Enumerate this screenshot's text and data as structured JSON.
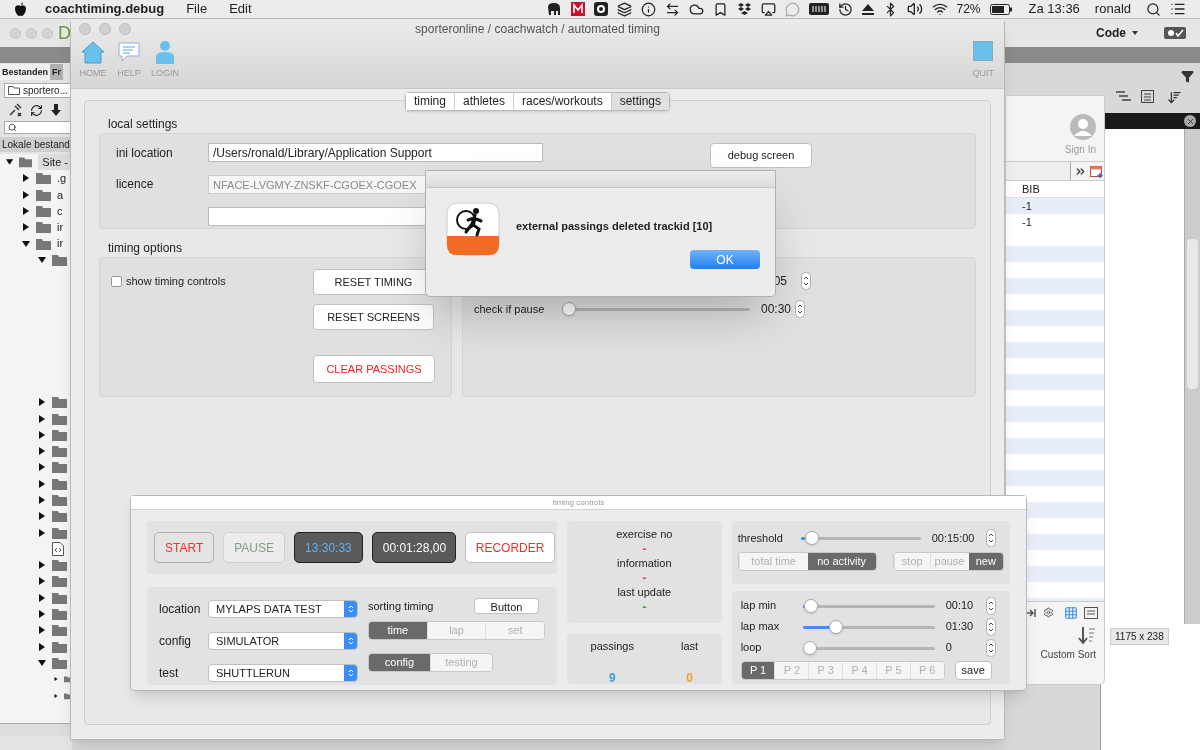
{
  "menubar": {
    "app": "coachtiming.debug",
    "menus": [
      "File",
      "Edit"
    ],
    "battery": "72%",
    "clock": "Za 13:36",
    "user": "ronald"
  },
  "back_window": {
    "logo": "D",
    "tabs": [
      {
        "label": "Bestanden",
        "selected": true
      },
      {
        "label": "Fr",
        "selected": false
      }
    ],
    "site_dropdown": "sportero...",
    "panel_header": "Lokale bestand",
    "code_menu": "Code",
    "tree": [
      {
        "label": "Site -",
        "kind": "folder",
        "expanded": true,
        "children": [
          {
            "label": ".g",
            "kind": "folder",
            "expanded": false
          },
          {
            "label": "a",
            "kind": "folder",
            "expanded": false
          },
          {
            "label": "c",
            "kind": "folder",
            "expanded": false
          },
          {
            "label": "ir",
            "kind": "folder",
            "expanded": false
          },
          {
            "label": "ir",
            "kind": "folder",
            "expanded": true,
            "children": [
              {
                "kind": "folder",
                "expanded": true
              },
              {
                "kind": "folder",
                "expanded": false
              },
              {
                "kind": "folder",
                "expanded": false
              },
              {
                "kind": "folder",
                "expanded": false
              },
              {
                "kind": "folder",
                "expanded": false
              },
              {
                "kind": "folder",
                "expanded": false
              },
              {
                "kind": "folder",
                "expanded": false
              },
              {
                "kind": "folder",
                "expanded": false
              },
              {
                "kind": "folder",
                "expanded": false
              },
              {
                "kind": "folder",
                "expanded": false
              },
              {
                "kind": "file"
              },
              {
                "kind": "folder",
                "expanded": false
              },
              {
                "kind": "folder",
                "expanded": false
              },
              {
                "kind": "folder",
                "expanded": false
              },
              {
                "kind": "folder",
                "expanded": false
              },
              {
                "kind": "folder",
                "expanded": false
              },
              {
                "kind": "folder",
                "expanded": false
              },
              {
                "kind": "folder",
                "expanded": true,
                "children": [
                  {
                    "kind": "folder",
                    "expanded": false
                  },
                  {
                    "kind": "folder",
                    "expanded": false
                  }
                ]
              }
            ]
          }
        ]
      }
    ]
  },
  "side_panel": {
    "sign_in": "Sign In",
    "table": {
      "columns": [
        "BIB"
      ],
      "rows": [
        "-1",
        "-1"
      ]
    },
    "custom_sort": "Custom Sort",
    "size_readout": "1175 x 238"
  },
  "main_window": {
    "title": "sporteronline / coachwatch / automated timing",
    "toolbar": [
      {
        "label": "HOME",
        "kind": "home"
      },
      {
        "label": "HELP",
        "kind": "help"
      },
      {
        "label": "LOGIN",
        "kind": "login"
      }
    ],
    "quit": "QUIT",
    "tabs": [
      {
        "label": "timing",
        "selected": false
      },
      {
        "label": "athletes",
        "selected": false
      },
      {
        "label": "races/workouts",
        "selected": false
      },
      {
        "label": "settings",
        "selected": true
      }
    ],
    "local_settings": {
      "title": "local settings",
      "ini_label": "ini location",
      "ini_value": "/Users/ronald/Library/Application Support",
      "licence_label": "licence",
      "licence_value": "NFACE-LVGMY-ZNSKF-CGOEX-CGOEX",
      "debug_button": "debug screen"
    },
    "timing_options": {
      "title": "timing options",
      "show_controls": {
        "label": "show timing controls",
        "checked": false
      },
      "buttons": [
        {
          "label": "RESET TIMING",
          "kind": "normal"
        },
        {
          "label": "RESET SCREENS",
          "kind": "normal"
        },
        {
          "label": "CLEAR PASSINGS",
          "kind": "danger"
        }
      ],
      "first_value": "05",
      "pause_slider": {
        "label": "check if pause",
        "level": 0,
        "value": "00:30"
      }
    }
  },
  "dialog": {
    "message": "external passings deleted trackid [10]",
    "ok": "OK"
  },
  "timing_controls": {
    "title": "timing controls",
    "buttons": [
      {
        "label": "START",
        "kind": "start"
      },
      {
        "label": "PAUSE",
        "kind": "pause"
      },
      {
        "label": "13:30:33",
        "kind": "clock"
      },
      {
        "label": "00:01:28,00",
        "kind": "elapsed"
      },
      {
        "label": "RECORDER",
        "kind": "recorder"
      }
    ],
    "selects": [
      {
        "label": "location",
        "value": "MYLAPS DATA TEST"
      },
      {
        "label": "config",
        "value": "SIMULATOR"
      },
      {
        "label": "test",
        "value": "SHUTTLERUN"
      }
    ],
    "sorting_label": "sorting timing",
    "sorting_button": "Button",
    "sort_segments": [
      {
        "label": "time",
        "selected": true
      },
      {
        "label": "lap",
        "selected": false
      },
      {
        "label": "set",
        "selected": false
      }
    ],
    "mode_segments": [
      {
        "label": "config",
        "selected": true
      },
      {
        "label": "testing",
        "selected": false
      }
    ],
    "info": [
      {
        "label": "exercise no",
        "value": "-",
        "color": "#e05050"
      },
      {
        "label": "information",
        "value": "-",
        "color": "#e05050"
      },
      {
        "label": "last update",
        "value": "-",
        "color": "#3aa040"
      }
    ],
    "counters": [
      {
        "label": "passings",
        "value": "9",
        "color": "#3a9ee0"
      },
      {
        "label": "last",
        "value": "0",
        "color": "#f0a030"
      }
    ],
    "threshold": {
      "label": "threshold",
      "level": 0.04,
      "value": "00:15:00"
    },
    "threshold_segments": [
      {
        "label": "total time",
        "selected": false
      },
      {
        "label": "no activity",
        "selected": true
      }
    ],
    "action_segments": [
      {
        "label": "stop",
        "selected": false
      },
      {
        "label": "pause",
        "selected": false
      },
      {
        "label": "new",
        "selected": true
      }
    ],
    "laps": [
      {
        "label": "lap min",
        "level": 0.01,
        "value": "00:10"
      },
      {
        "label": "lap max",
        "level": 0.22,
        "value": "01:30"
      },
      {
        "label": "loop",
        "level": 0,
        "value": "0"
      }
    ],
    "presets": [
      {
        "label": "P 1",
        "selected": true
      },
      {
        "label": "P 2",
        "selected": false
      },
      {
        "label": "P 3",
        "selected": false
      },
      {
        "label": "P 4",
        "selected": false
      },
      {
        "label": "P 5",
        "selected": false
      },
      {
        "label": "P 6",
        "selected": false
      }
    ],
    "save": "save"
  }
}
